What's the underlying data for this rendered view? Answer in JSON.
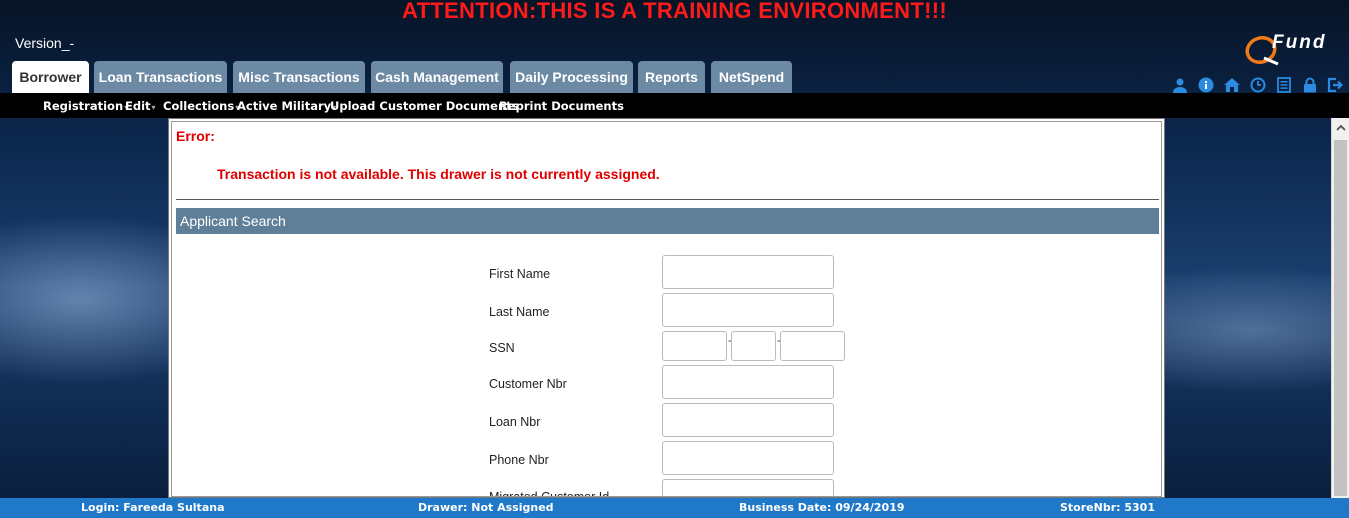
{
  "banner": "ATTENTION:THIS IS A TRAINING ENVIRONMENT!!!",
  "version": "Version_-",
  "logo": {
    "text": "Fund",
    "mark": "Q"
  },
  "tabs": [
    {
      "label": "Borrower",
      "active": true
    },
    {
      "label": "Loan Transactions",
      "active": false
    },
    {
      "label": "Misc Transactions",
      "active": false
    },
    {
      "label": "Cash Management",
      "active": false
    },
    {
      "label": "Daily Processing",
      "active": false
    },
    {
      "label": "Reports",
      "active": false
    },
    {
      "label": "NetSpend",
      "active": false
    }
  ],
  "header_icons": [
    "user-icon",
    "info-icon",
    "home-icon",
    "clock-icon",
    "list-icon",
    "lock-icon",
    "logout-icon"
  ],
  "submenu": [
    {
      "label": "Registration",
      "dropdown": true
    },
    {
      "label": "Edit",
      "dropdown": true
    },
    {
      "label": "Collections",
      "dropdown": true
    },
    {
      "label": "Active Military",
      "dropdown": true
    },
    {
      "label": "Upload Customer Documents",
      "dropdown": false
    },
    {
      "label": "Reprint Documents",
      "dropdown": false
    }
  ],
  "error": {
    "label": "Error:",
    "message": "Transaction is not available. This drawer is not currently assigned."
  },
  "search": {
    "title": "Applicant Search",
    "fields": {
      "first_name": "First Name",
      "last_name": "Last Name",
      "ssn": "SSN",
      "customer_nbr": "Customer Nbr",
      "loan_nbr": "Loan Nbr",
      "phone_nbr": "Phone Nbr",
      "migrated_id": "Migrated Customer Id"
    },
    "ssn_separator": "-"
  },
  "status": {
    "login": "Login: Fareeda Sultana",
    "drawer": "Drawer: Not Assigned",
    "business_date": "Business Date: 09/24/2019",
    "store": "StoreNbr: 5301"
  },
  "colors": {
    "banner": "#ff1a1a",
    "tab": "#6d8aa5",
    "section_header": "#5f7f98",
    "statusbar": "#1f78c8",
    "error": "#e00000"
  }
}
